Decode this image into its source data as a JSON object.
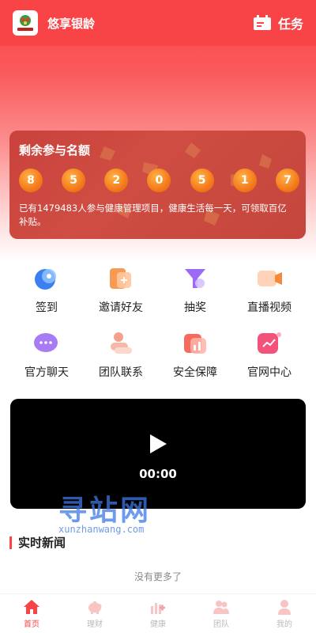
{
  "header": {
    "app_name": "悠享银龄",
    "logo_text": "悠享银龄",
    "task_label": "任务"
  },
  "quota": {
    "title": "剩余参与名额",
    "digits": [
      "8",
      "5",
      "2",
      "0",
      "5",
      "1",
      "7"
    ],
    "description": "已有1479483人参与健康管理项目，健康生活每一天，可领取百亿补贴。"
  },
  "menu": [
    {
      "label": "签到",
      "icon": "checkin-icon"
    },
    {
      "label": "邀请好友",
      "icon": "invite-icon"
    },
    {
      "label": "抽奖",
      "icon": "lottery-icon"
    },
    {
      "label": "直播视频",
      "icon": "live-video-icon"
    },
    {
      "label": "官方聊天",
      "icon": "chat-icon"
    },
    {
      "label": "团队联系",
      "icon": "team-contact-icon"
    },
    {
      "label": "安全保障",
      "icon": "security-icon"
    },
    {
      "label": "官网中心",
      "icon": "website-icon"
    }
  ],
  "video": {
    "time": "00:00"
  },
  "watermark": {
    "cn": "寻站网",
    "en": "xunzhanwang.com"
  },
  "news": {
    "title": "实时新闻",
    "empty": "没有更多了"
  },
  "tabs": [
    {
      "label": "首页",
      "icon": "home-icon"
    },
    {
      "label": "理财",
      "icon": "piggy-bank-icon"
    },
    {
      "label": "健康",
      "icon": "health-icon"
    },
    {
      "label": "团队",
      "icon": "team-icon"
    },
    {
      "label": "我的",
      "icon": "user-icon"
    }
  ],
  "colors": {
    "brand": "#f84447",
    "digit": "#f47a1a"
  }
}
